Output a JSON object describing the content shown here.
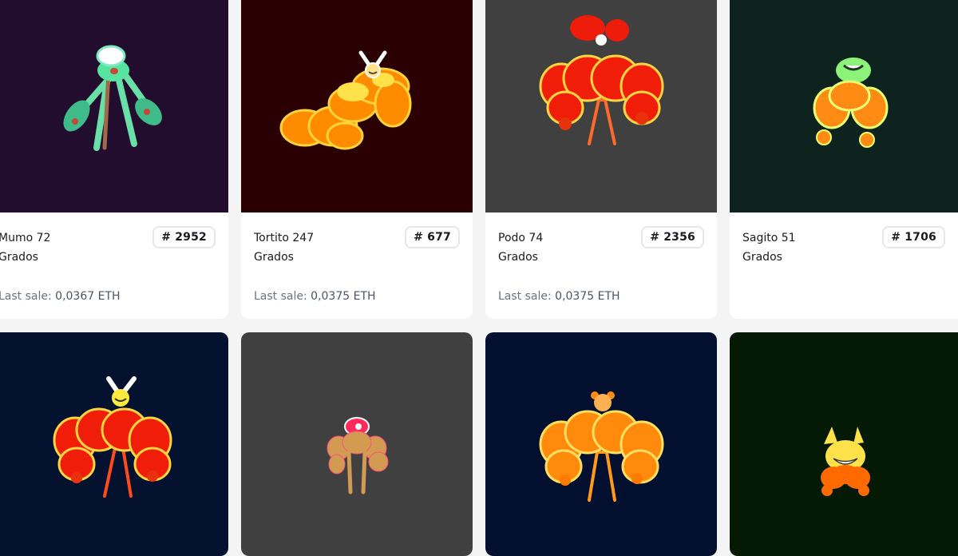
{
  "cards": [
    {
      "name": "Mumo 72",
      "collection": "Grados",
      "id": "# 2952",
      "sale_label": "Last sale:",
      "sale_value": "0,0367 ETH",
      "bg": "#230d2f"
    },
    {
      "name": "Tortito 247",
      "collection": "Grados",
      "id": "# 677",
      "sale_label": "Last sale:",
      "sale_value": "0,0375 ETH",
      "bg": "#2a0003"
    },
    {
      "name": "Podo 74",
      "collection": "Grados",
      "id": "# 2356",
      "sale_label": "Last sale:",
      "sale_value": "0,0375 ETH",
      "bg": "#404040"
    },
    {
      "name": "Sagito 51",
      "collection": "Grados",
      "id": "# 1706",
      "sale_label": "",
      "sale_value": "",
      "bg": "#0e231e"
    },
    {
      "bg": "#041230"
    },
    {
      "bg": "#404040"
    },
    {
      "bg": "#030f2e"
    },
    {
      "bg": "#051a04"
    }
  ]
}
